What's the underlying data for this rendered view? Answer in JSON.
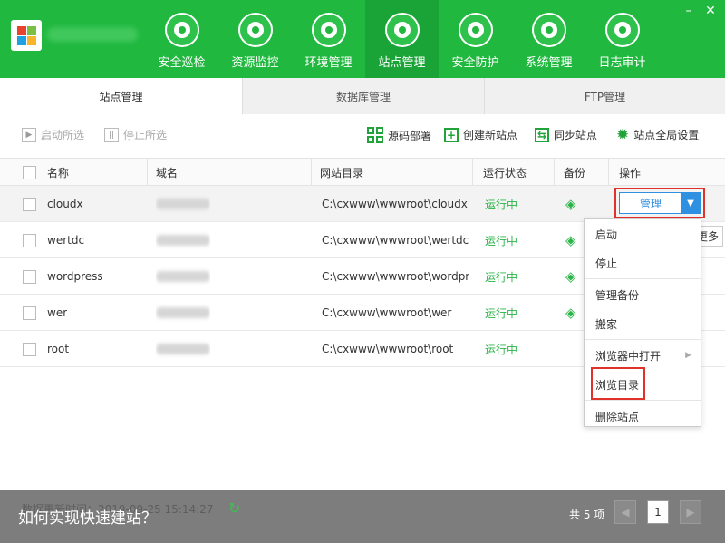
{
  "window": {
    "minimize_label": "–",
    "close_label": "✕"
  },
  "nav": [
    {
      "label": "安全巡检",
      "icon": "radar-icon"
    },
    {
      "label": "资源监控",
      "icon": "monitor-icon"
    },
    {
      "label": "环境管理",
      "icon": "building-icon"
    },
    {
      "label": "站点管理",
      "icon": "globe-icon",
      "active": true
    },
    {
      "label": "安全防护",
      "icon": "shield-icon"
    },
    {
      "label": "系统管理",
      "icon": "gear-screen-icon"
    },
    {
      "label": "日志审计",
      "icon": "document-icon"
    }
  ],
  "tabs": [
    "站点管理",
    "数据库管理",
    "FTP管理"
  ],
  "toolbar": {
    "start_selected": "启动所选",
    "stop_selected": "停止所选",
    "deploy_source": "源码部署",
    "create_site": "创建新站点",
    "sync_site": "同步站点",
    "global_settings": "站点全局设置"
  },
  "table": {
    "headers": {
      "name": "名称",
      "domain": "域名",
      "dir": "网站目录",
      "status": "运行状态",
      "backup": "备份",
      "ops": "操作"
    },
    "rows": [
      {
        "name": "cloudx",
        "dir": "C:\\cxwww\\wwwroot\\cloudx",
        "status": "运行中"
      },
      {
        "name": "wertdc",
        "dir": "C:\\cxwww\\wwwroot\\wertdc",
        "status": "运行中"
      },
      {
        "name": "wordpress",
        "dir": "C:\\cxwww\\wwwroot\\wordpr",
        "status": "运行中"
      },
      {
        "name": "wer",
        "dir": "C:\\cxwww\\wwwroot\\wer",
        "status": "运行中"
      },
      {
        "name": "root",
        "dir": "C:\\cxwww\\wwwroot\\root",
        "status": "运行中"
      }
    ]
  },
  "manage_button": {
    "label": "管理",
    "more": "更多"
  },
  "dropdown": [
    "启动",
    "停止",
    "管理备份",
    "搬家",
    "浏览器中打开",
    "浏览目录",
    "删除站点"
  ],
  "footer": {
    "time_text": "数据更新时间：2019-09-25 15:14:27",
    "caption": "如何实现快速建站？",
    "total": "共 5 项",
    "page": "1"
  },
  "colors": {
    "brand": "#20b83f",
    "status_green": "#2db34a",
    "accent_blue": "#2f8fe0",
    "highlight_red": "#e0312a"
  }
}
